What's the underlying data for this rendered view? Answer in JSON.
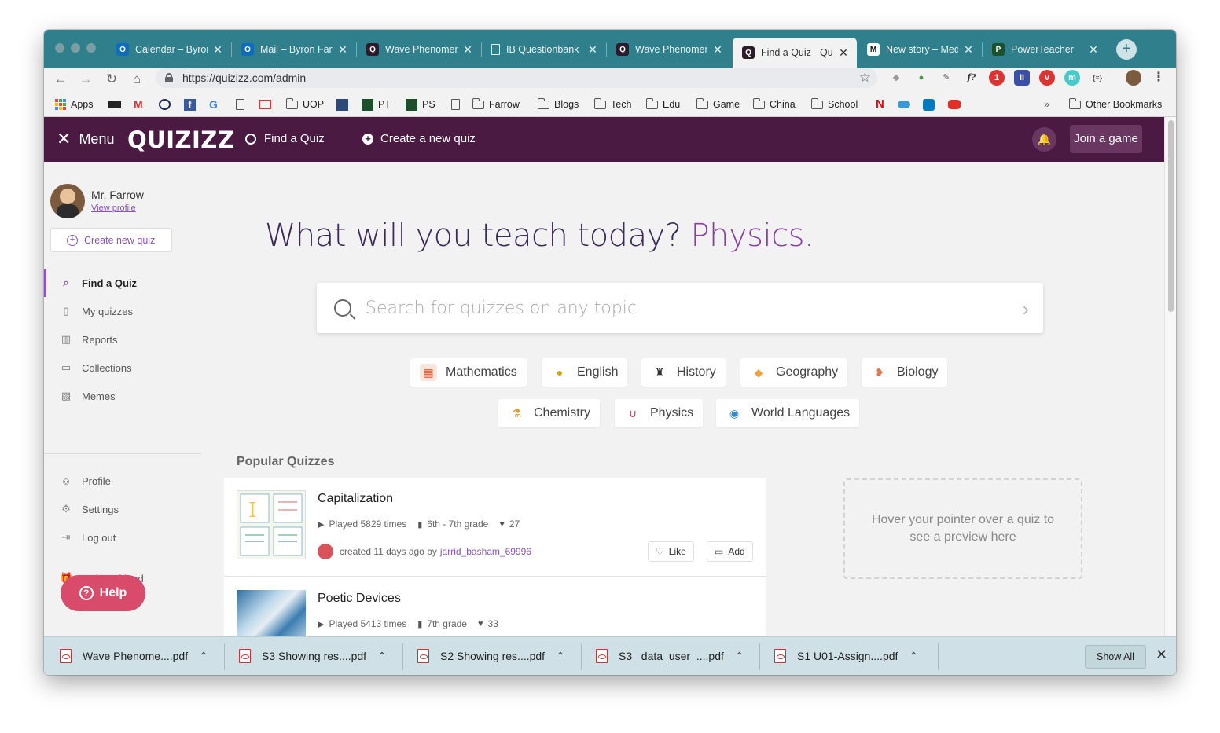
{
  "browser": {
    "tabs": [
      {
        "title": "Calendar – Byron",
        "fav": "O",
        "fav_color": "#0f6cbd"
      },
      {
        "title": "Mail – Byron Farr",
        "fav": "O",
        "fav_color": "#0f6cbd"
      },
      {
        "title": "Wave Phenomen",
        "fav": "Q",
        "fav_color": "#2d1b2b"
      },
      {
        "title": "IB Questionbank",
        "fav": "",
        "fav_color": "transparent"
      },
      {
        "title": "Wave Phenomen",
        "fav": "Q",
        "fav_color": "#2d1b2b"
      },
      {
        "title": "Find a Quiz - Qui",
        "fav": "Q",
        "fav_color": "#2d1b2b"
      },
      {
        "title": "New story – Med",
        "fav": "M",
        "fav_color": "#111111"
      },
      {
        "title": "PowerTeacher",
        "fav": "P",
        "fav_color": "#1d4f2b"
      }
    ],
    "url": "https://quizizz.com/admin",
    "bookmarks": [
      {
        "label": "Apps",
        "kind": "apps"
      },
      {
        "label": "",
        "kind": "bbc"
      },
      {
        "label": "",
        "kind": "gmail"
      },
      {
        "label": "",
        "kind": "circle"
      },
      {
        "label": "",
        "kind": "facebook"
      },
      {
        "label": "",
        "kind": "google"
      },
      {
        "label": "",
        "kind": "page"
      },
      {
        "label": "",
        "kind": "mail"
      },
      {
        "label": "UOP",
        "kind": "folder"
      },
      {
        "label": "",
        "kind": "puzzle"
      },
      {
        "label": "PT",
        "kind": "ps"
      },
      {
        "label": "PS",
        "kind": "ps"
      },
      {
        "label": "",
        "kind": "page"
      },
      {
        "label": "Farrow",
        "kind": "folder"
      },
      {
        "label": "Blogs",
        "kind": "folder"
      },
      {
        "label": "Tech",
        "kind": "folder"
      },
      {
        "label": "Edu",
        "kind": "folder"
      },
      {
        "label": "Game",
        "kind": "folder"
      },
      {
        "label": "China",
        "kind": "folder"
      },
      {
        "label": "School",
        "kind": "folder"
      }
    ],
    "more_bookmarks": "»",
    "other_bookmarks": "Other Bookmarks"
  },
  "header": {
    "menu_label": "Menu",
    "logo": "QUIZIZZ",
    "find_quiz": "Find a Quiz",
    "create_quiz": "Create a new quiz",
    "join_game": "Join a game"
  },
  "sidebar": {
    "user_name": "Mr. Farrow",
    "view_profile": "View profile",
    "create_new_quiz": "Create new quiz",
    "nav": [
      {
        "label": "Find a Quiz",
        "icon": "search-icon",
        "active": true
      },
      {
        "label": "My quizzes",
        "icon": "document-icon",
        "active": false
      },
      {
        "label": "Reports",
        "icon": "bar-chart-icon",
        "active": false
      },
      {
        "label": "Collections",
        "icon": "folder-icon",
        "active": false
      },
      {
        "label": "Memes",
        "icon": "image-icon",
        "active": false
      }
    ],
    "nav2": [
      {
        "label": "Profile",
        "icon": "user-icon"
      },
      {
        "label": "Settings",
        "icon": "gear-icon"
      },
      {
        "label": "Log out",
        "icon": "logout-icon"
      },
      {
        "label": "Refer a friend",
        "icon": "gift-icon"
      }
    ],
    "help": "Help"
  },
  "main": {
    "hero_text": "What will you teach today?",
    "hero_subject": "Physics.",
    "search_placeholder": "Search for quizzes on any topic",
    "subjects_row1": [
      "Mathematics",
      "English",
      "History",
      "Geography",
      "Biology"
    ],
    "subjects_row2": [
      "Chemistry",
      "Physics",
      "World Languages"
    ],
    "popular_title": "Popular Quizzes",
    "quizzes": [
      {
        "name": "Capitalization",
        "played": "Played 5829 times",
        "grade": "6th - 7th grade",
        "likes": "27",
        "created": "created 11 days ago by",
        "author": "jarrid_basham_69996"
      },
      {
        "name": "Poetic Devices",
        "played": "Played 5413 times",
        "grade": "7th grade",
        "likes": "33"
      }
    ],
    "like_label": "Like",
    "add_label": "Add",
    "preview_hint": "Hover your pointer over a quiz to see a preview here"
  },
  "downloads": {
    "files": [
      "Wave Phenome....pdf",
      "S3 Showing res....pdf",
      "S2 Showing res....pdf",
      "S3 _data_user_....pdf",
      "S1 U01-Assign....pdf"
    ],
    "show_all": "Show All"
  },
  "colors": {
    "tab_strip": "#2f7f8c",
    "quizizz_header": "#4b1a43",
    "accent_purple": "#8854c0",
    "help_pink": "#d94b6a"
  }
}
